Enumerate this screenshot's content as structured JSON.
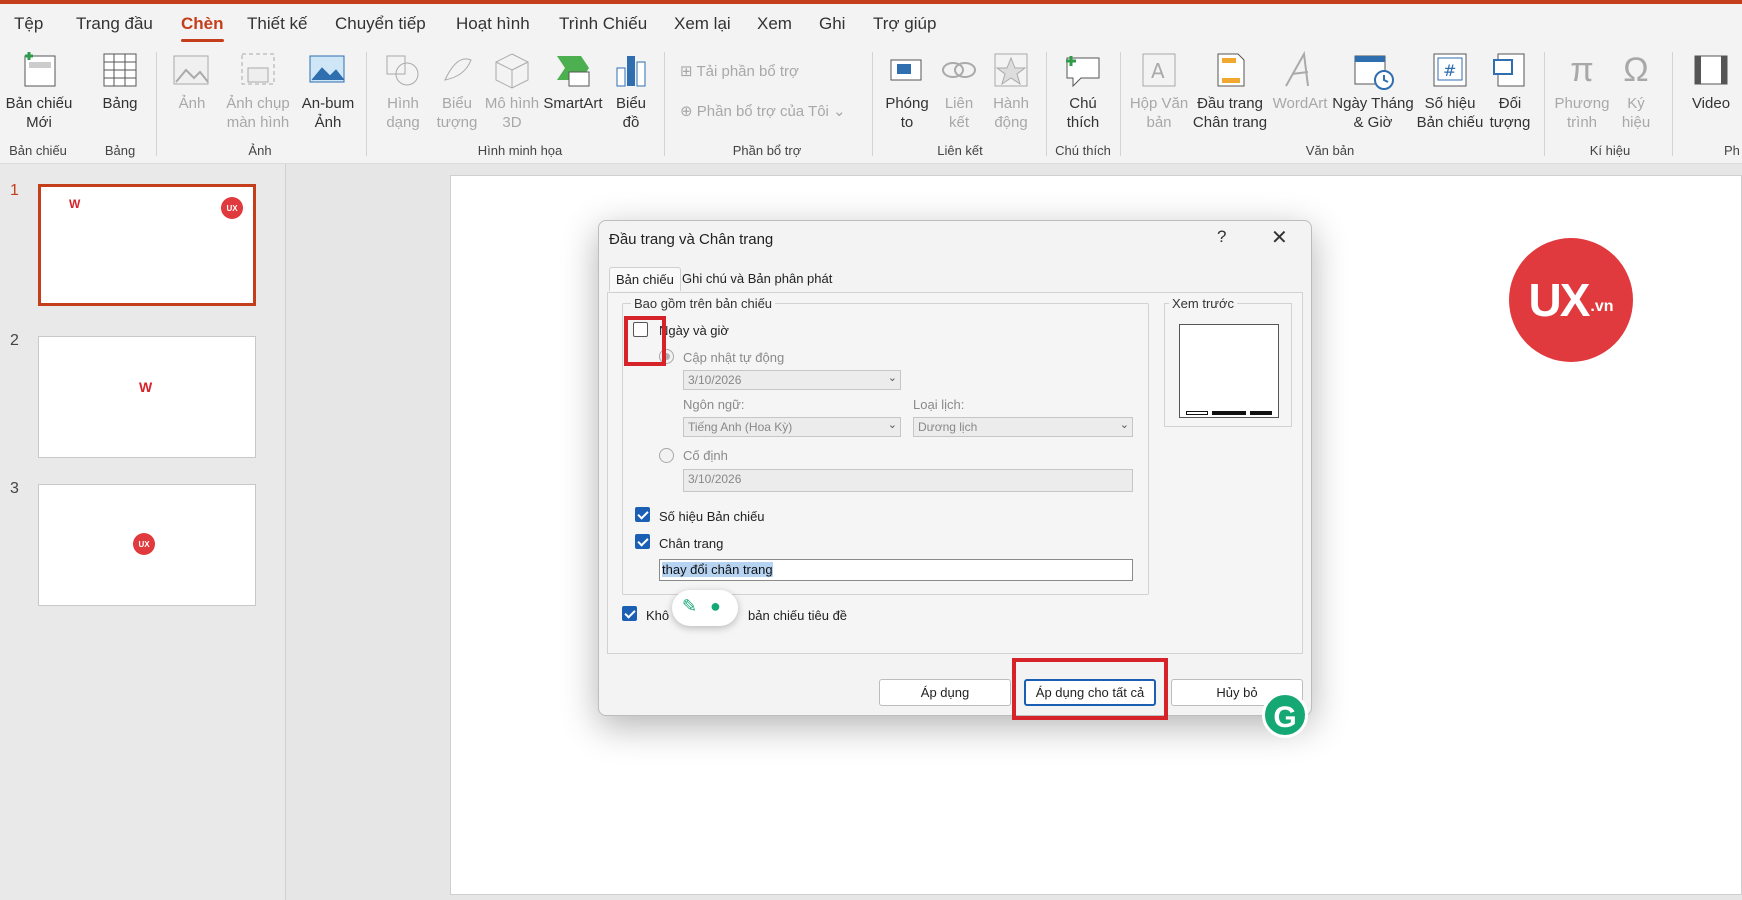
{
  "menu": {
    "tabs": [
      "Tệp",
      "Trang đầu",
      "Chèn",
      "Thiết kế",
      "Chuyển tiếp",
      "Hoạt hình",
      "Trình Chiếu",
      "Xem lại",
      "Xem",
      "Ghi",
      "Trợ giúp"
    ],
    "active_tab": "Chèn"
  },
  "ribbon": {
    "new_slide": "Bản chiếu Mới",
    "table": "Bảng",
    "picture": "Ảnh",
    "screenshot": "Ảnh chụp màn hình",
    "album": "An-bum Ảnh",
    "shapes": "Hình dạng",
    "icons": "Biểu tượng",
    "model3d": "Mô hình 3D",
    "smartart": "SmartArt",
    "chart": "Biểu đồ",
    "get_addins": "Tải phần bổ trợ",
    "my_addins": "Phần bổ trợ của Tôi",
    "zoom": "Phóng to",
    "link": "Liên kết",
    "action": "Hành động",
    "comment": "Chú thích",
    "textbox": "Hộp Văn bản",
    "header_footer": "Đầu trang Chân trang",
    "wordart": "WordArt",
    "date_time": "Ngày Tháng & Giờ",
    "slide_number": "Số hiệu Bản chiếu",
    "object": "Đối tượng",
    "equation": "Phương trình",
    "symbol": "Ký hiệu",
    "video": "Video",
    "groups": {
      "slides": "Bản chiếu",
      "tables": "Bảng",
      "images": "Ảnh",
      "illustrations": "Hình minh họa",
      "addins": "Phần bổ trợ",
      "links": "Liên kết",
      "comments": "Chú thích",
      "text": "Văn bản",
      "symbols": "Kí hiệu",
      "media": "Ph"
    }
  },
  "thumbnails": [
    "1",
    "2",
    "3"
  ],
  "logo": {
    "ux": "UX",
    "vn": ".vn"
  },
  "dialog": {
    "title": "Đầu trang và Chân trang",
    "help": "?",
    "close": "✕",
    "tabs": [
      "Bản chiếu",
      "Ghi chú và Bản phân phát"
    ],
    "group_label": "Bao gồm trên bản chiếu",
    "date_time_label": "Ngày và giờ",
    "auto_update_label": "Cập nhật tự động",
    "auto_date_value": "3/10/2026",
    "language_label": "Ngôn ngữ:",
    "language_value": "Tiếng Anh (Hoa Kỳ)",
    "calendar_label": "Loại lịch:",
    "calendar_value": "Dương lịch",
    "fixed_label": "Cố định",
    "fixed_value": "3/10/2026",
    "slide_number_label": "Số hiệu Bản chiếu",
    "footer_label": "Chân trang",
    "footer_value": "thay đổi chân trang",
    "dont_show_prefix": "Khô",
    "dont_show_suffix": "bản chiếu tiêu đề",
    "preview_label": "Xem trước",
    "apply_label": "Áp dụng",
    "apply_all_label": "Áp dụng cho tất cả",
    "cancel_label": "Hủy bỏ",
    "checks": {
      "date_time": false,
      "slide_number": true,
      "footer": true,
      "dont_show_title": true
    }
  },
  "grammarly": {
    "logo": "G"
  },
  "colors": {
    "accent": "#c43e1c",
    "highlight": "#d6232a",
    "logo_red": "#e03a3e",
    "checkbox_blue": "#1a5fb4"
  }
}
